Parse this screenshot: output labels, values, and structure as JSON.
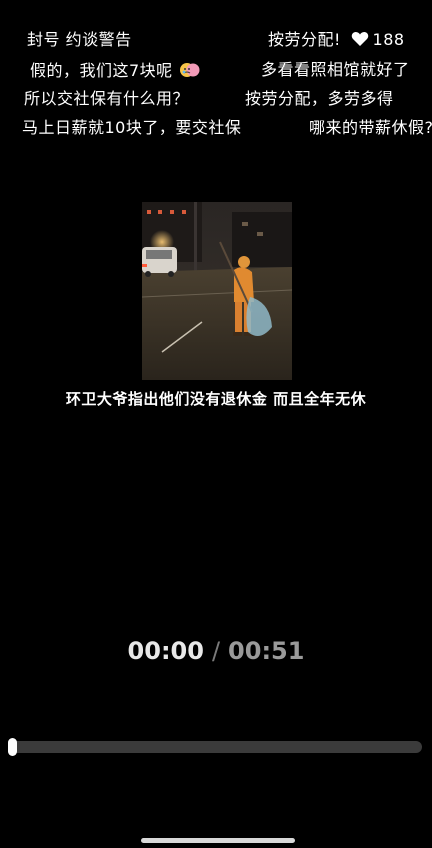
{
  "danmaku": {
    "line1_left": "封号  约谈警告",
    "line1_right_text": "按劳分配!",
    "like_count": "188",
    "line2_left": "假的，我们这7块呢",
    "line2_right": "多看看照相馆就好了",
    "line3_left": "所以交社保有什么用？",
    "line3_right": "按劳分配，多劳多得",
    "line4_left": "马上日薪就10块了，要交社保",
    "line4_right": "哪来的带薪休假?"
  },
  "video": {
    "caption": "环卫大爷指出他们没有退休金 而且全年无休"
  },
  "player": {
    "current_time": "00:00",
    "separator": "/",
    "total_time": "00:51",
    "progress_fraction": 0.0
  },
  "icons": {
    "heart": "heart-icon",
    "emoji": "crying-face-emoji"
  }
}
